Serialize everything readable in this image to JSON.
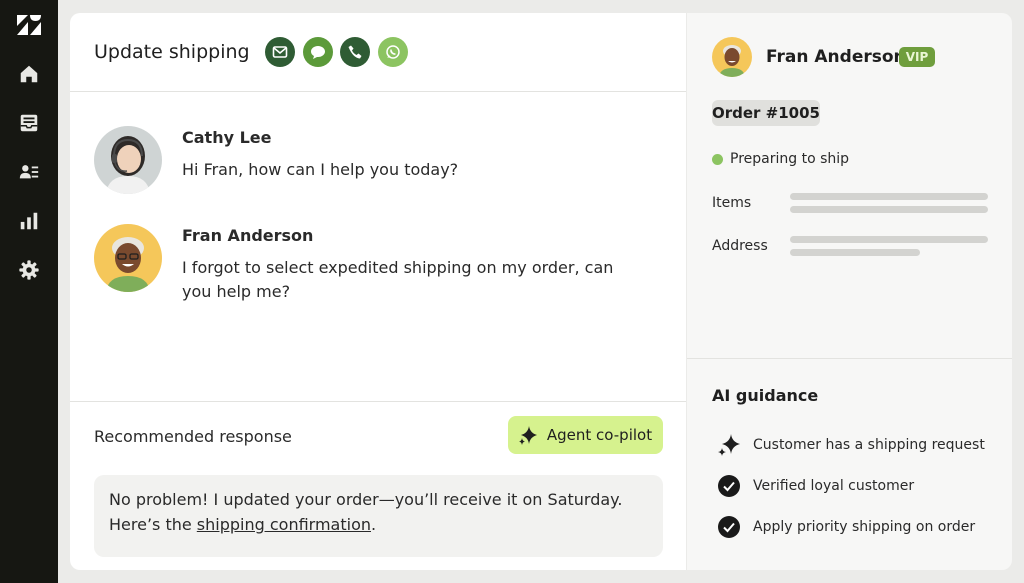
{
  "sidebar": {
    "items": [
      {
        "icon": "home-icon"
      },
      {
        "icon": "inbox-icon"
      },
      {
        "icon": "contacts-icon"
      },
      {
        "icon": "reports-icon"
      },
      {
        "icon": "settings-icon"
      }
    ]
  },
  "header": {
    "title": "Update shipping",
    "channels": [
      "email-icon",
      "chat-icon",
      "phone-icon",
      "whatsapp-icon"
    ]
  },
  "messages": [
    {
      "name": "Cathy Lee",
      "text": "Hi Fran, how can I help you today?"
    },
    {
      "name": "Fran Anderson",
      "text": "I forgot to select expedited shipping on my order, can you help me?"
    }
  ],
  "recommended": {
    "label": "Recommended response",
    "copilot_label": "Agent co-pilot",
    "text_before": "No problem! I updated your order—you’ll receive it on Saturday. Here’s the ",
    "link": "shipping confirmation",
    "text_after": "."
  },
  "customer": {
    "name": "Fran Anderson",
    "badge": "VIP",
    "order": "Order #1005",
    "status": "Preparing to ship",
    "items_label": "Items",
    "address_label": "Address"
  },
  "ai_guidance": {
    "title": "AI guidance",
    "items": [
      {
        "icon": "sparkle-icon",
        "text": "Customer has a shipping request"
      },
      {
        "icon": "check-circle-icon",
        "text": "Verified loyal customer"
      },
      {
        "icon": "check-circle-icon",
        "text": "Apply priority shipping on order"
      }
    ]
  },
  "colors": {
    "sidebar": "#161712",
    "accent_green": "#2f5c34",
    "copilot": "#d6f28e",
    "vip": "#6f9e3d",
    "status": "#8cc461"
  }
}
